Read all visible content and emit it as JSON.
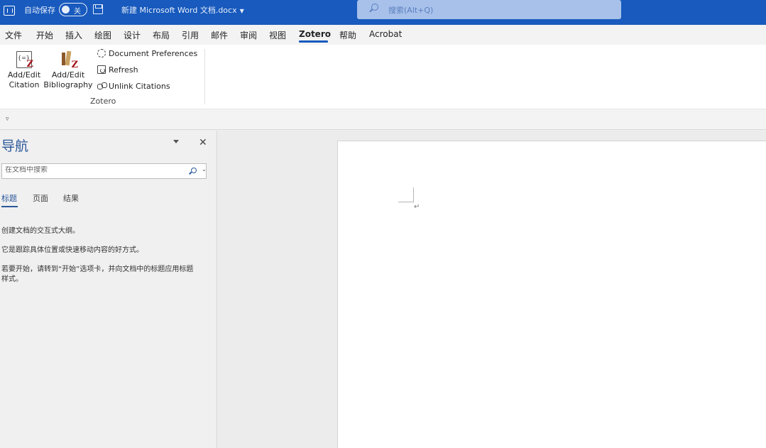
{
  "titlebar": {
    "autosave_label": "自动保存",
    "autosave_state": "关",
    "doc_title": "新建 Microsoft Word 文档.docx",
    "search_placeholder": "搜索(Alt+Q)"
  },
  "menu": {
    "tabs": [
      {
        "label": "文件"
      },
      {
        "label": "开始"
      },
      {
        "label": "插入"
      },
      {
        "label": "绘图"
      },
      {
        "label": "设计"
      },
      {
        "label": "布局"
      },
      {
        "label": "引用"
      },
      {
        "label": "邮件"
      },
      {
        "label": "审阅"
      },
      {
        "label": "视图"
      },
      {
        "label": "Zotero",
        "active": true
      },
      {
        "label": "帮助"
      },
      {
        "label": "Acrobat"
      }
    ]
  },
  "ribbon": {
    "add_edit_citation_line1": "Add/Edit",
    "add_edit_citation_line2": "Citation",
    "add_edit_bibliography_line1": "Add/Edit",
    "add_edit_bibliography_line2": "Bibliography",
    "document_preferences": "Document Preferences",
    "refresh": "Refresh",
    "unlink_citations": "Unlink Citations",
    "group_label": "Zotero"
  },
  "navigation": {
    "title": "导航",
    "search_placeholder": "在文档中搜索",
    "tabs": [
      "标题",
      "页面",
      "结果"
    ],
    "active_tab": "标题",
    "message_1": "创建文档的交互式大纲。",
    "message_2": "它是跟踪具体位置或快速移动内容的好方式。",
    "message_3a": "若要开始，请转到“开始”选项卡，并向文档中的标题应用标题",
    "message_3b": "样式。"
  },
  "document": {
    "paragraph_mark": "↵"
  },
  "colors": {
    "title_bar": "#185abd",
    "accent": "#2b579a"
  }
}
